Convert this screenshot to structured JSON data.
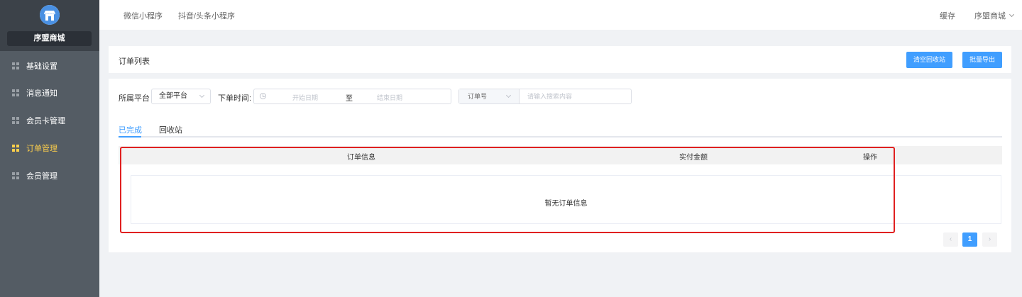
{
  "sidebar": {
    "store_name": "序盟商城",
    "items": [
      {
        "label": "基础设置",
        "icon": "grid-icon",
        "active": false
      },
      {
        "label": "消息通知",
        "icon": "grid-icon",
        "active": false
      },
      {
        "label": "会员卡管理",
        "icon": "grid-icon",
        "active": false
      },
      {
        "label": "订单管理",
        "icon": "grid-icon",
        "active": true
      },
      {
        "label": "会员管理",
        "icon": "grid-icon",
        "active": false
      }
    ]
  },
  "topbar": {
    "tabs": [
      "微信小程序",
      "抖音/头条小程序"
    ],
    "cache_label": "缓存",
    "store_dropdown": "序盟商城"
  },
  "header": {
    "title": "订单列表",
    "clear_recycle_button": "清空回收站",
    "batch_export_button": "批量导出"
  },
  "filters": {
    "platform_label": "所属平台",
    "platform_value": "全部平台",
    "time_label": "下单时间:",
    "start_placeholder": "开始日期",
    "range_separator": "至",
    "end_placeholder": "结束日期",
    "search_field": "订单号",
    "search_placeholder": "请输入搜索内容"
  },
  "tabs": [
    {
      "label": "已完成",
      "active": true
    },
    {
      "label": "回收站",
      "active": false
    }
  ],
  "table": {
    "columns": [
      "订单信息",
      "实付金额",
      "操作"
    ],
    "empty_text": "暂无订单信息"
  },
  "pagination": {
    "prev": "‹",
    "current": "1",
    "next": "›"
  },
  "colors": {
    "accent": "#409eff",
    "sidebar_bg": "#545c64",
    "active_nav": "#ffd04b",
    "highlight_border": "#e02020"
  }
}
